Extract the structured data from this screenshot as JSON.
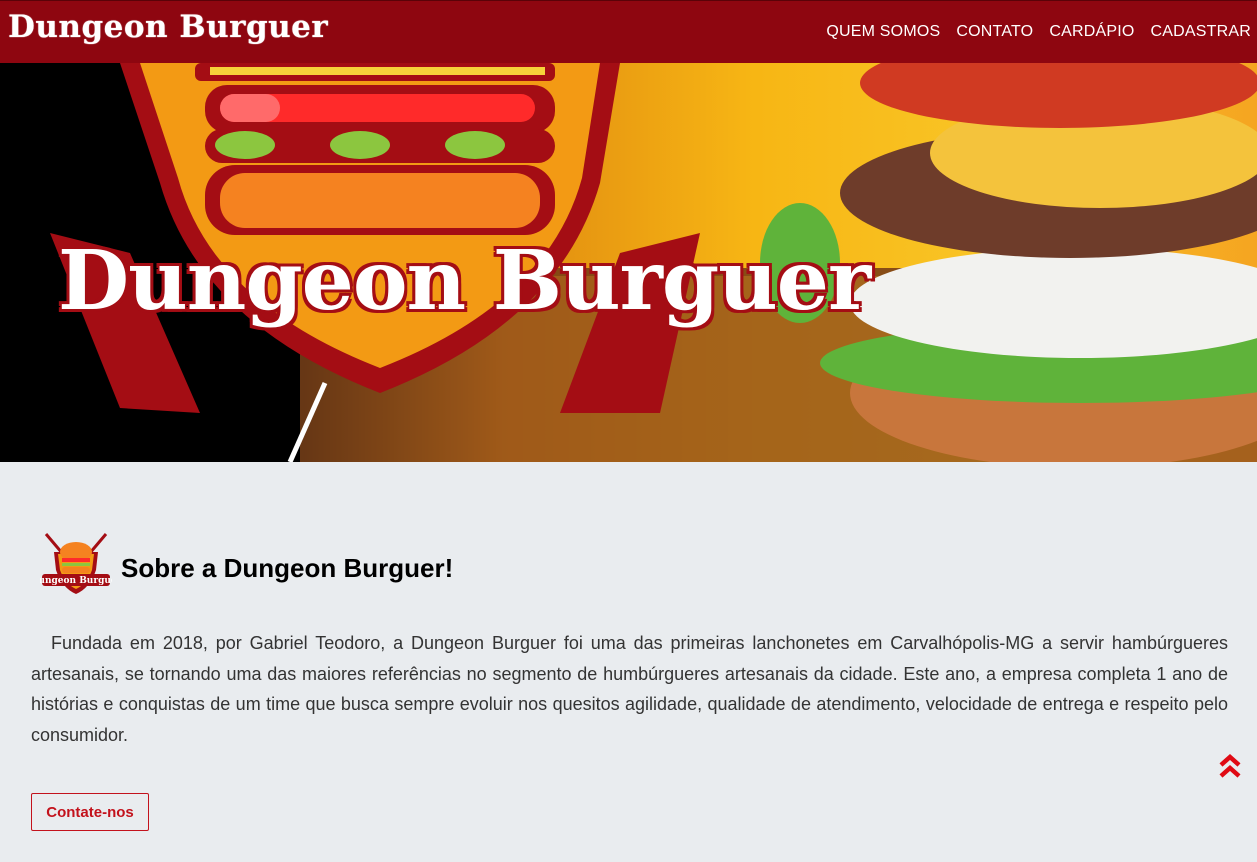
{
  "navbar": {
    "brand": "Dungeon Burguer",
    "links": [
      "QUEM SOMOS",
      "CONTATO",
      "CARDÁPIO",
      "CADASTRAR"
    ]
  },
  "hero": {
    "banner_title": "Dungeon Burguer"
  },
  "about": {
    "logo_text": "Dungeon Burguer",
    "title": "Sobre a Dungeon Burguer!",
    "text": "Fundada em 2018, por Gabriel Teodoro, a Dungeon Burguer foi uma das primeiras lanchonetes em Carvalhópolis-MG a servir hambúrgueres artesanais, se tornando uma das maiores referências no segmento de humbúrgueres artesanais da cidade. Este ano, a empresa completa 1 ano de histórias e conquistas de um time que busca sempre evoluir nos quesitos agilidade, qualidade de atendimento, velocidade de entrega e respeito pelo consumidor.",
    "button_label": "Contate-nos"
  },
  "icons": {
    "scroll_top": "double-chevron-up-icon"
  },
  "colors": {
    "navbar": "#8e0610",
    "accent": "#c3121c",
    "background": "#e9ecef"
  }
}
